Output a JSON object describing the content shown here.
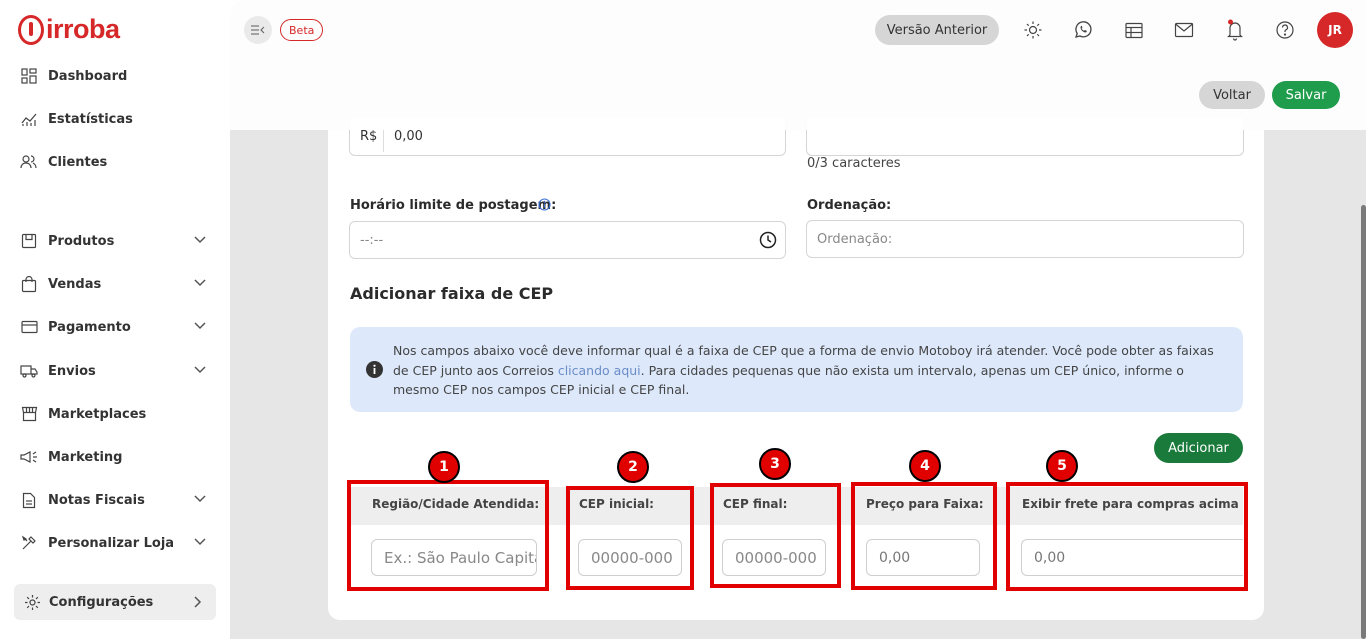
{
  "brand": {
    "name": "irroba"
  },
  "sidebar": {
    "items": [
      {
        "label": "Dashboard",
        "icon": "dashboard-icon",
        "has_chevron": false
      },
      {
        "label": "Estatísticas",
        "icon": "chart-line-icon",
        "has_chevron": false
      },
      {
        "label": "Clientes",
        "icon": "users-icon",
        "has_chevron": false
      },
      {
        "label": "Produtos",
        "icon": "box-icon",
        "has_chevron": true
      },
      {
        "label": "Vendas",
        "icon": "shopping-bag-icon",
        "has_chevron": true
      },
      {
        "label": "Pagamento",
        "icon": "credit-card-icon",
        "has_chevron": true
      },
      {
        "label": "Envios",
        "icon": "truck-icon",
        "has_chevron": true
      },
      {
        "label": "Marketplaces",
        "icon": "store-icon",
        "has_chevron": false
      },
      {
        "label": "Marketing",
        "icon": "megaphone-icon",
        "has_chevron": false
      },
      {
        "label": "Notas Fiscais",
        "icon": "document-icon",
        "has_chevron": true
      },
      {
        "label": "Personalizar Loja",
        "icon": "tools-icon",
        "has_chevron": true
      }
    ],
    "config": {
      "label": "Configurações",
      "icon": "gear-icon"
    }
  },
  "topbar": {
    "beta_label": "Beta",
    "versao_label": "Versão Anterior",
    "avatar_initials": "JR",
    "voltar_label": "Voltar",
    "salvar_label": "Salvar"
  },
  "form": {
    "currency_prefix": "R$",
    "price_value": "0,00",
    "char_counter": "0/3 caracteres",
    "horario_label": "Horário limite de postagem:",
    "horario_placeholder": "--:--",
    "ordenacao_label": "Ordenação:",
    "ordenacao_placeholder": "Ordenação:",
    "section_title": "Adicionar faixa de CEP",
    "info_text_1": "Nos campos abaixo você deve informar qual é a faixa de CEP que a forma de envio Motoboy irá atender. Você pode obter as faixas de CEP junto aos Correios ",
    "info_link": "clicando aqui",
    "info_text_2": ". Para cidades pequenas que não exista um intervalo, apenas um CEP único, informe o mesmo CEP nos campos CEP inicial e CEP final.",
    "adicionar_label": "Adicionar"
  },
  "table": {
    "columns": [
      {
        "header": "Região/Cidade Atendida:",
        "placeholder": "Ex.: São Paulo Capital"
      },
      {
        "header": "CEP inicial:",
        "placeholder": "00000-000"
      },
      {
        "header": "CEP final:",
        "placeholder": "00000-000"
      },
      {
        "header": "Preço para Faixa:",
        "placeholder": "0,00"
      },
      {
        "header": "Exibir frete para compras acima de:",
        "placeholder": "0,00"
      }
    ]
  },
  "annotations": [
    "1",
    "2",
    "3",
    "4",
    "5"
  ],
  "colors": {
    "brand": "#d62828",
    "success": "#1f9d4c",
    "highlight": "#e00000",
    "info_bg": "#dde9fb"
  }
}
